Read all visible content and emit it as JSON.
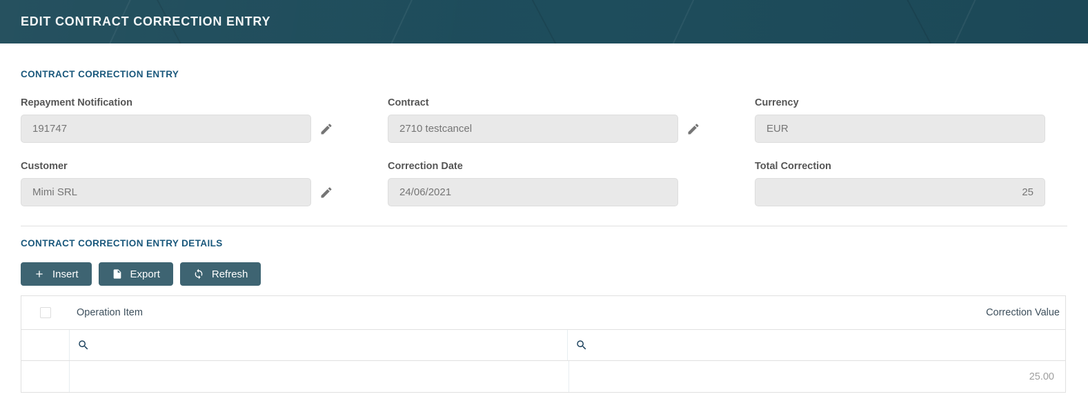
{
  "header": {
    "title": "EDIT CONTRACT CORRECTION ENTRY"
  },
  "entry_section": {
    "title": "CONTRACT CORRECTION ENTRY",
    "fields": [
      {
        "label": "Repayment Notification",
        "value": "191747",
        "editable": true,
        "align": "left"
      },
      {
        "label": "Contract",
        "value": "2710 testcancel",
        "editable": true,
        "align": "left"
      },
      {
        "label": "Currency",
        "value": "EUR",
        "editable": false,
        "align": "left"
      },
      {
        "label": "Customer",
        "value": "Mimi SRL",
        "editable": true,
        "align": "left"
      },
      {
        "label": "Correction Date",
        "value": "24/06/2021",
        "editable": false,
        "align": "left"
      },
      {
        "label": "Total Correction",
        "value": "25",
        "editable": false,
        "align": "right"
      }
    ]
  },
  "details_section": {
    "title": "CONTRACT CORRECTION ENTRY DETAILS",
    "toolbar": {
      "insert_label": "Insert",
      "export_label": "Export",
      "refresh_label": "Refresh"
    },
    "table": {
      "columns": {
        "operation_item": "Operation Item",
        "correction_value": "Correction Value"
      },
      "rows": [
        {
          "operation_item": "",
          "correction_value": "25.00"
        }
      ]
    }
  },
  "colors": {
    "topbar_background": "#1d4a59",
    "section_heading": "#1a587c",
    "button_background": "#3e6472",
    "input_background": "#e9e9e9",
    "input_text": "#757575",
    "table_border": "#e0e0e0",
    "muted_value_text": "#9e9e9e"
  },
  "icons": {
    "edit": "pencil-icon",
    "insert": "plus-icon",
    "export": "document-icon",
    "refresh": "sync-icon",
    "filter": "search-icon"
  }
}
